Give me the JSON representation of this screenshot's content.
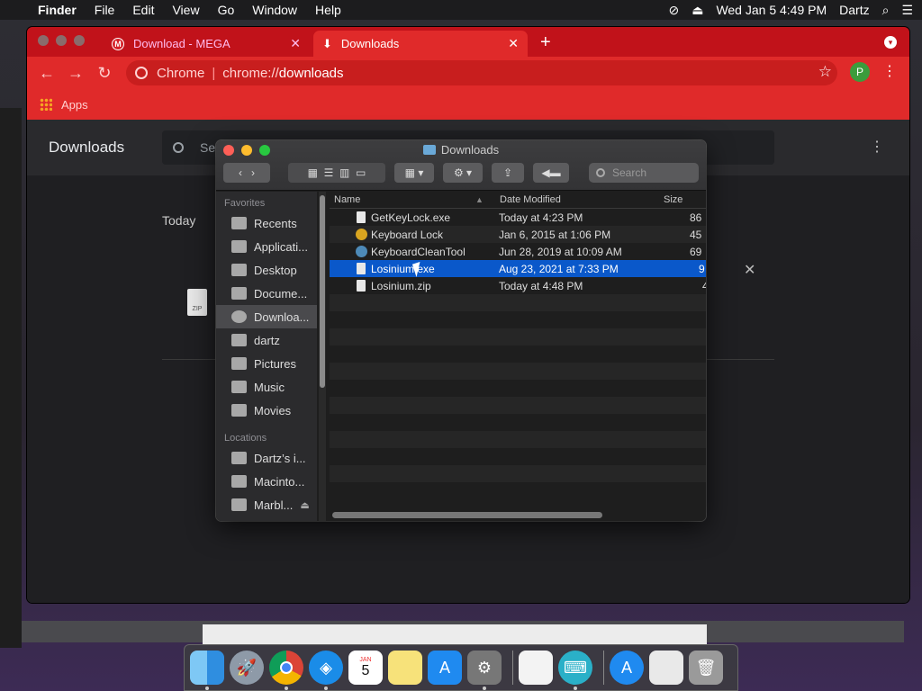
{
  "menubar": {
    "app": "Finder",
    "items": [
      "File",
      "Edit",
      "View",
      "Go",
      "Window",
      "Help"
    ],
    "datetime": "Wed Jan 5  4:49 PM",
    "user": "Dartz"
  },
  "chrome": {
    "tabs": [
      {
        "label": "Download - MEGA",
        "active": false
      },
      {
        "label": "Downloads",
        "active": true
      }
    ],
    "omnibox": {
      "origin": "Chrome",
      "path_prefix": "chrome://",
      "path_bold": "downloads"
    },
    "avatar_letter": "P",
    "bookmarks_apps": "Apps",
    "downloads_page": {
      "title": "Downloads",
      "search_placeholder": "Se",
      "section": "Today",
      "file_icon_label": "ZIP"
    },
    "colors": {
      "tabstrip": "#c1121a",
      "toolbar": "#e02a2a"
    }
  },
  "finder": {
    "title": "Downloads",
    "search_placeholder": "Search",
    "sidebar": {
      "favorites_heading": "Favorites",
      "favorites": [
        "Recents",
        "Applicati...",
        "Desktop",
        "Docume...",
        "Downloa...",
        "dartz",
        "Pictures",
        "Music",
        "Movies"
      ],
      "selected": "Downloa...",
      "locations_heading": "Locations",
      "locations": [
        "Dartz’s i...",
        "Macinto...",
        "Marbl..."
      ]
    },
    "columns": {
      "name": "Name",
      "date": "Date Modified",
      "size": "Size"
    },
    "files": [
      {
        "name": "GetKeyLock.exe",
        "date": "Today at 4:23 PM",
        "size": "86",
        "icon": "document-icon"
      },
      {
        "name": "Keyboard Lock",
        "date": "Jan 6, 2015 at 1:06 PM",
        "size": "45",
        "icon": "app-icon"
      },
      {
        "name": "KeyboardCleanTool",
        "date": "Jun 28, 2019 at 10:09 AM",
        "size": "69",
        "icon": "app-icon"
      },
      {
        "name": "Losinium.exe",
        "date": "Aug 23, 2021 at 7:33 PM",
        "size": "9",
        "icon": "document-icon",
        "selected": true
      },
      {
        "name": "Losinium.zip",
        "date": "Today at 4:48 PM",
        "size": "4",
        "icon": "zip-icon"
      }
    ]
  },
  "dock": {
    "apps": [
      "finder-icon",
      "launchpad-icon",
      "chrome-icon",
      "safari-icon",
      "calendar-icon",
      "notes-icon",
      "app-store-icon",
      "system-preferences-icon",
      "textedit-icon",
      "keyboard-cleaner-icon",
      "app-store-icon-2",
      "document-icon",
      "trash-icon"
    ],
    "calendar": {
      "month": "JAN",
      "day": "5"
    }
  }
}
